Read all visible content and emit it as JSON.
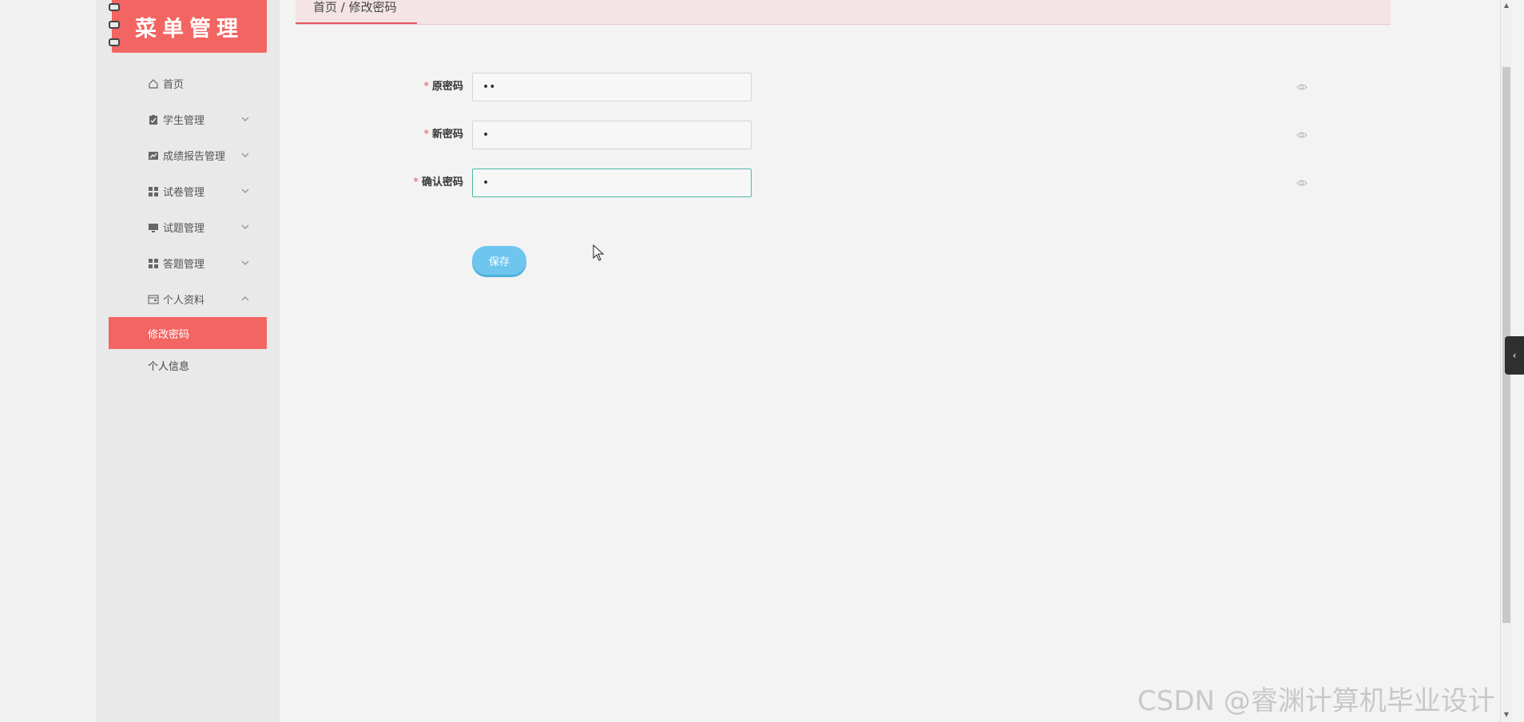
{
  "sidebar": {
    "logo_text": "菜单管理",
    "items": [
      {
        "label": "首页",
        "icon": "home-icon",
        "has_chevron": false
      },
      {
        "label": "学生管理",
        "icon": "clipboard-icon",
        "has_chevron": true
      },
      {
        "label": "成绩报告管理",
        "icon": "chart-icon",
        "has_chevron": true
      },
      {
        "label": "试卷管理",
        "icon": "grid-icon",
        "has_chevron": true
      },
      {
        "label": "试题管理",
        "icon": "monitor-icon",
        "has_chevron": true
      },
      {
        "label": "答题管理",
        "icon": "grid-icon",
        "has_chevron": true
      },
      {
        "label": "个人资料",
        "icon": "profile-card-icon",
        "has_chevron": true,
        "expanded": true
      }
    ],
    "sub_items": [
      {
        "label": "修改密码",
        "active": true
      },
      {
        "label": "个人信息",
        "active": false
      }
    ]
  },
  "header": {
    "breadcrumb": "首页 / 修改密码"
  },
  "form": {
    "fields": [
      {
        "label": "原密码",
        "value": "••",
        "required": true
      },
      {
        "label": "新密码",
        "value": "•",
        "required": true
      },
      {
        "label": "确认密码",
        "value": "•",
        "required": true,
        "focused": true
      }
    ],
    "save_label": "保存"
  },
  "watermark": "CSDN @睿渊计算机毕业设计",
  "colors": {
    "brand": "#f26562",
    "button": "#6ec6ee",
    "focus": "#4fb8a6"
  }
}
